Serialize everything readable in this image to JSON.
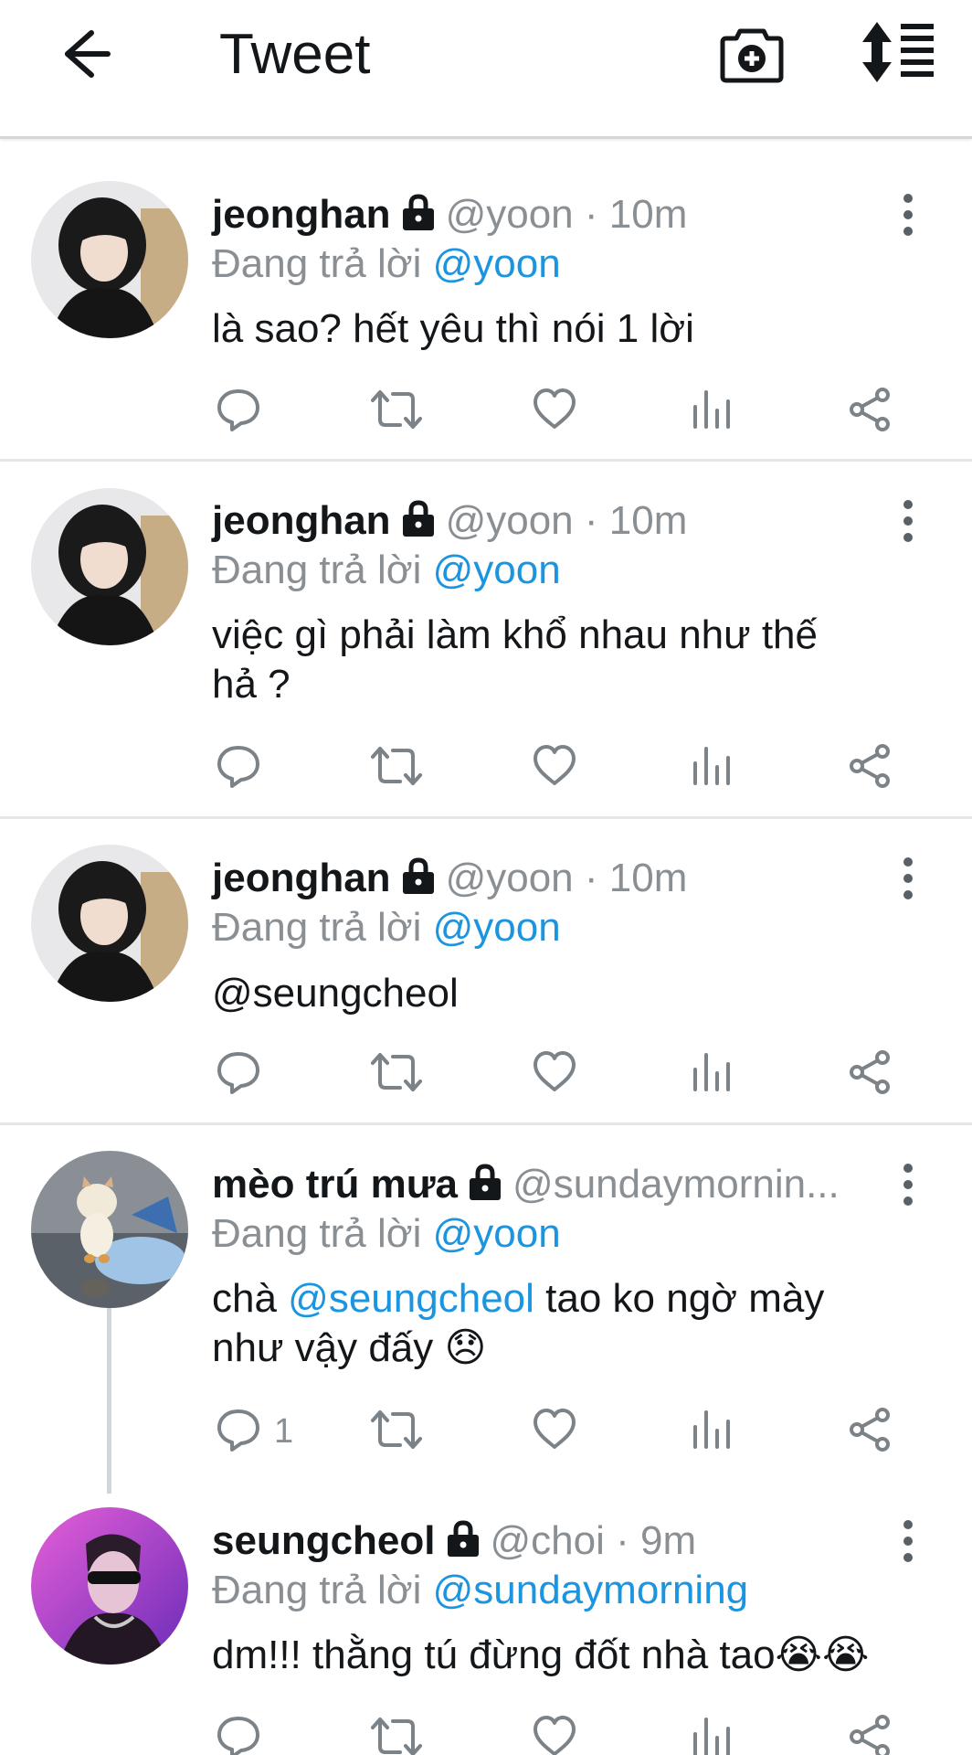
{
  "topbar": {
    "title": "Tweet",
    "icons": [
      "back-arrow-icon",
      "camera-add-icon",
      "sort-icon"
    ]
  },
  "tweets": [
    {
      "name": "jeonghan",
      "handle": "@yoon",
      "time": "10m",
      "replying_prefix": "Đang trả lời",
      "replying_to": "@yoon",
      "text": "là sao? hết yêu thì nói 1 lời",
      "reply_count": ""
    },
    {
      "name": "jeonghan",
      "handle": "@yoon",
      "time": "10m",
      "replying_prefix": "Đang trả lời",
      "replying_to": "@yoon",
      "text": "việc gì phải làm khổ nhau như thế hả ?",
      "reply_count": ""
    },
    {
      "name": "jeonghan",
      "handle": "@yoon",
      "time": "10m",
      "replying_prefix": "Đang trả lời",
      "replying_to": "@yoon",
      "text": "@seungcheol",
      "reply_count": ""
    },
    {
      "name": "mèo trú mưa",
      "handle": "@sundaymornin...",
      "time": "",
      "replying_prefix": "Đang trả lời",
      "replying_to": "@yoon",
      "text_parts": [
        "chà ",
        "@seungcheol",
        " tao ko ngờ mày như vậy đấy 😞"
      ],
      "reply_count": "1"
    },
    {
      "name": "seungcheol",
      "handle": "@choi",
      "time": "9m",
      "replying_prefix": "Đang trả lời",
      "replying_to": "@sundaymorning",
      "text": "dm!!! thằng tú đừng đốt nhà tao😭😭",
      "reply_count": ""
    }
  ],
  "separator": " · ",
  "colors": {
    "link_blue": "#1b95e0",
    "secondary_gray": "#8a8f94",
    "text_dark": "#14171a",
    "divider": "#e6e6e6"
  }
}
